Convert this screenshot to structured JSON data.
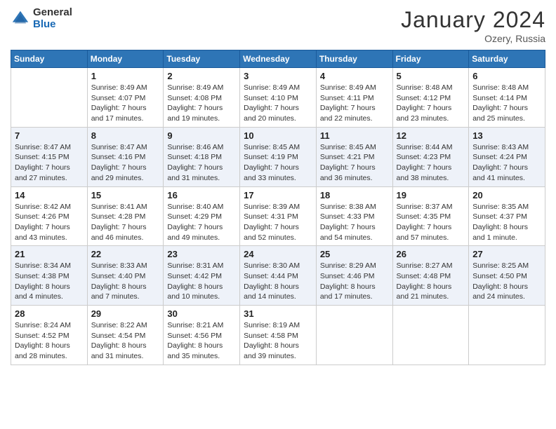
{
  "logo": {
    "general": "General",
    "blue": "Blue"
  },
  "header": {
    "month_title": "January 2024",
    "location": "Ozery, Russia"
  },
  "weekdays": [
    "Sunday",
    "Monday",
    "Tuesday",
    "Wednesday",
    "Thursday",
    "Friday",
    "Saturday"
  ],
  "weeks": [
    [
      {
        "day": "",
        "detail": ""
      },
      {
        "day": "1",
        "detail": "Sunrise: 8:49 AM\nSunset: 4:07 PM\nDaylight: 7 hours\nand 17 minutes."
      },
      {
        "day": "2",
        "detail": "Sunrise: 8:49 AM\nSunset: 4:08 PM\nDaylight: 7 hours\nand 19 minutes."
      },
      {
        "day": "3",
        "detail": "Sunrise: 8:49 AM\nSunset: 4:10 PM\nDaylight: 7 hours\nand 20 minutes."
      },
      {
        "day": "4",
        "detail": "Sunrise: 8:49 AM\nSunset: 4:11 PM\nDaylight: 7 hours\nand 22 minutes."
      },
      {
        "day": "5",
        "detail": "Sunrise: 8:48 AM\nSunset: 4:12 PM\nDaylight: 7 hours\nand 23 minutes."
      },
      {
        "day": "6",
        "detail": "Sunrise: 8:48 AM\nSunset: 4:14 PM\nDaylight: 7 hours\nand 25 minutes."
      }
    ],
    [
      {
        "day": "7",
        "detail": "Sunrise: 8:47 AM\nSunset: 4:15 PM\nDaylight: 7 hours\nand 27 minutes."
      },
      {
        "day": "8",
        "detail": "Sunrise: 8:47 AM\nSunset: 4:16 PM\nDaylight: 7 hours\nand 29 minutes."
      },
      {
        "day": "9",
        "detail": "Sunrise: 8:46 AM\nSunset: 4:18 PM\nDaylight: 7 hours\nand 31 minutes."
      },
      {
        "day": "10",
        "detail": "Sunrise: 8:45 AM\nSunset: 4:19 PM\nDaylight: 7 hours\nand 33 minutes."
      },
      {
        "day": "11",
        "detail": "Sunrise: 8:45 AM\nSunset: 4:21 PM\nDaylight: 7 hours\nand 36 minutes."
      },
      {
        "day": "12",
        "detail": "Sunrise: 8:44 AM\nSunset: 4:23 PM\nDaylight: 7 hours\nand 38 minutes."
      },
      {
        "day": "13",
        "detail": "Sunrise: 8:43 AM\nSunset: 4:24 PM\nDaylight: 7 hours\nand 41 minutes."
      }
    ],
    [
      {
        "day": "14",
        "detail": "Sunrise: 8:42 AM\nSunset: 4:26 PM\nDaylight: 7 hours\nand 43 minutes."
      },
      {
        "day": "15",
        "detail": "Sunrise: 8:41 AM\nSunset: 4:28 PM\nDaylight: 7 hours\nand 46 minutes."
      },
      {
        "day": "16",
        "detail": "Sunrise: 8:40 AM\nSunset: 4:29 PM\nDaylight: 7 hours\nand 49 minutes."
      },
      {
        "day": "17",
        "detail": "Sunrise: 8:39 AM\nSunset: 4:31 PM\nDaylight: 7 hours\nand 52 minutes."
      },
      {
        "day": "18",
        "detail": "Sunrise: 8:38 AM\nSunset: 4:33 PM\nDaylight: 7 hours\nand 54 minutes."
      },
      {
        "day": "19",
        "detail": "Sunrise: 8:37 AM\nSunset: 4:35 PM\nDaylight: 7 hours\nand 57 minutes."
      },
      {
        "day": "20",
        "detail": "Sunrise: 8:35 AM\nSunset: 4:37 PM\nDaylight: 8 hours\nand 1 minute."
      }
    ],
    [
      {
        "day": "21",
        "detail": "Sunrise: 8:34 AM\nSunset: 4:38 PM\nDaylight: 8 hours\nand 4 minutes."
      },
      {
        "day": "22",
        "detail": "Sunrise: 8:33 AM\nSunset: 4:40 PM\nDaylight: 8 hours\nand 7 minutes."
      },
      {
        "day": "23",
        "detail": "Sunrise: 8:31 AM\nSunset: 4:42 PM\nDaylight: 8 hours\nand 10 minutes."
      },
      {
        "day": "24",
        "detail": "Sunrise: 8:30 AM\nSunset: 4:44 PM\nDaylight: 8 hours\nand 14 minutes."
      },
      {
        "day": "25",
        "detail": "Sunrise: 8:29 AM\nSunset: 4:46 PM\nDaylight: 8 hours\nand 17 minutes."
      },
      {
        "day": "26",
        "detail": "Sunrise: 8:27 AM\nSunset: 4:48 PM\nDaylight: 8 hours\nand 21 minutes."
      },
      {
        "day": "27",
        "detail": "Sunrise: 8:25 AM\nSunset: 4:50 PM\nDaylight: 8 hours\nand 24 minutes."
      }
    ],
    [
      {
        "day": "28",
        "detail": "Sunrise: 8:24 AM\nSunset: 4:52 PM\nDaylight: 8 hours\nand 28 minutes."
      },
      {
        "day": "29",
        "detail": "Sunrise: 8:22 AM\nSunset: 4:54 PM\nDaylight: 8 hours\nand 31 minutes."
      },
      {
        "day": "30",
        "detail": "Sunrise: 8:21 AM\nSunset: 4:56 PM\nDaylight: 8 hours\nand 35 minutes."
      },
      {
        "day": "31",
        "detail": "Sunrise: 8:19 AM\nSunset: 4:58 PM\nDaylight: 8 hours\nand 39 minutes."
      },
      {
        "day": "",
        "detail": ""
      },
      {
        "day": "",
        "detail": ""
      },
      {
        "day": "",
        "detail": ""
      }
    ]
  ]
}
